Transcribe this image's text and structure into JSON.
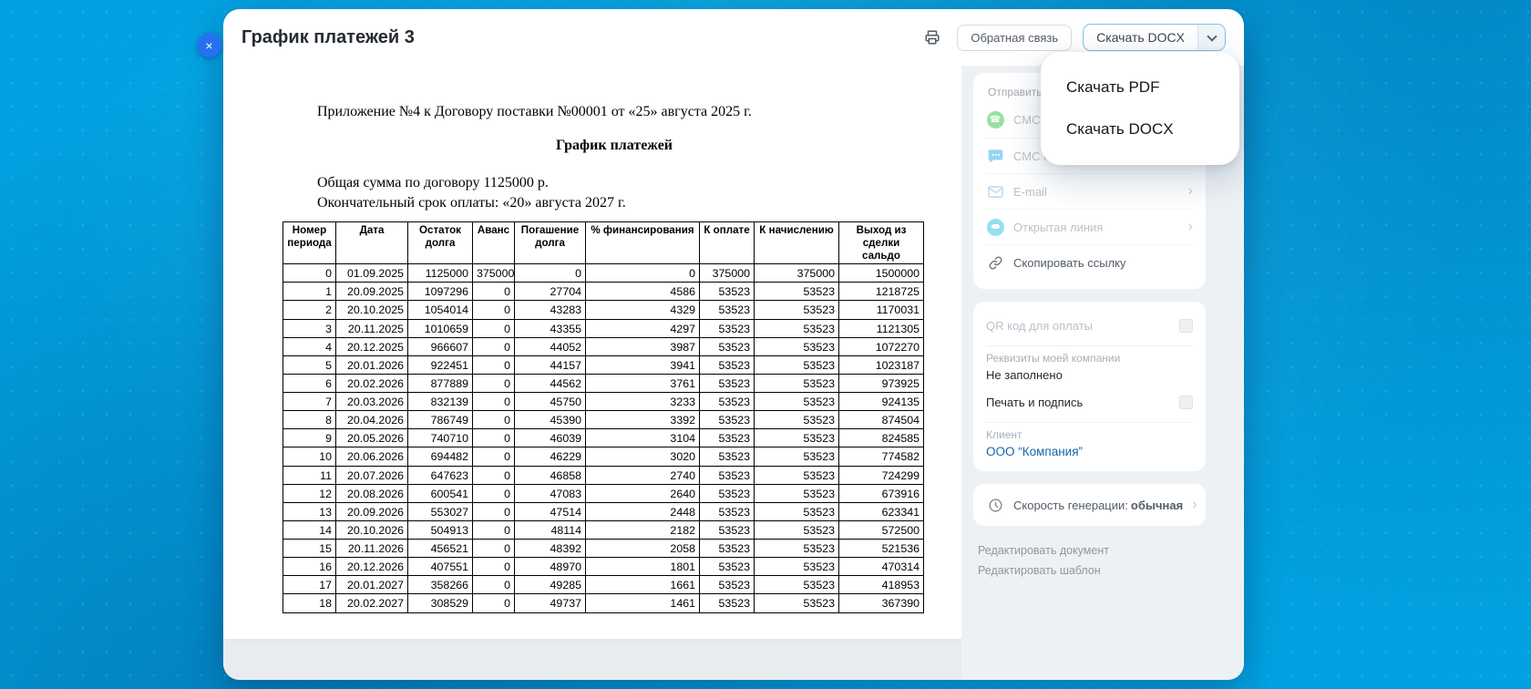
{
  "window": {
    "title": "График платежей 3",
    "close_glyph": "×"
  },
  "toolbar": {
    "feedback_label": "Обратная связь",
    "download_label": "Скачать DOCX"
  },
  "dropdown": {
    "items": [
      "Скачать PDF",
      "Скачать DOCX"
    ]
  },
  "document": {
    "appendix_line": "Приложение №4 к Договору поставки №00001 от «25» августа 2025 г.",
    "title": "График платежей",
    "total_line": "Общая сумма по договору 1125000 р.",
    "deadline_line": "Окончательный срок оплаты: «20» августа 2027 г.",
    "table": {
      "headers": [
        "Номер\nпериода",
        "Дата",
        "Остаток\nдолга",
        "Аванс",
        "Погашение\nдолга",
        "% финансирования",
        "К оплате",
        "К начислению",
        "Выход из\nсделки\nсальдо"
      ],
      "rows": [
        [
          "0",
          "01.09.2025",
          "1125000",
          "375000",
          "0",
          "0",
          "375000",
          "375000",
          "1500000"
        ],
        [
          "1",
          "20.09.2025",
          "1097296",
          "0",
          "27704",
          "4586",
          "53523",
          "53523",
          "1218725"
        ],
        [
          "2",
          "20.10.2025",
          "1054014",
          "0",
          "43283",
          "4329",
          "53523",
          "53523",
          "1170031"
        ],
        [
          "3",
          "20.11.2025",
          "1010659",
          "0",
          "43355",
          "4297",
          "53523",
          "53523",
          "1121305"
        ],
        [
          "4",
          "20.12.2025",
          "966607",
          "0",
          "44052",
          "3987",
          "53523",
          "53523",
          "1072270"
        ],
        [
          "5",
          "20.01.2026",
          "922451",
          "0",
          "44157",
          "3941",
          "53523",
          "53523",
          "1023187"
        ],
        [
          "6",
          "20.02.2026",
          "877889",
          "0",
          "44562",
          "3761",
          "53523",
          "53523",
          "973925"
        ],
        [
          "7",
          "20.03.2026",
          "832139",
          "0",
          "45750",
          "3233",
          "53523",
          "53523",
          "924135"
        ],
        [
          "8",
          "20.04.2026",
          "786749",
          "0",
          "45390",
          "3392",
          "53523",
          "53523",
          "874504"
        ],
        [
          "9",
          "20.05.2026",
          "740710",
          "0",
          "46039",
          "3104",
          "53523",
          "53523",
          "824585"
        ],
        [
          "10",
          "20.06.2026",
          "694482",
          "0",
          "46229",
          "3020",
          "53523",
          "53523",
          "774582"
        ],
        [
          "11",
          "20.07.2026",
          "647623",
          "0",
          "46858",
          "2740",
          "53523",
          "53523",
          "724299"
        ],
        [
          "12",
          "20.08.2026",
          "600541",
          "0",
          "47083",
          "2640",
          "53523",
          "53523",
          "673916"
        ],
        [
          "13",
          "20.09.2026",
          "553027",
          "0",
          "47514",
          "2448",
          "53523",
          "53523",
          "623341"
        ],
        [
          "14",
          "20.10.2026",
          "504913",
          "0",
          "48114",
          "2182",
          "53523",
          "53523",
          "572500"
        ],
        [
          "15",
          "20.11.2026",
          "456521",
          "0",
          "48392",
          "2058",
          "53523",
          "53523",
          "521536"
        ],
        [
          "16",
          "20.12.2026",
          "407551",
          "0",
          "48970",
          "1801",
          "53523",
          "53523",
          "470314"
        ],
        [
          "17",
          "20.01.2027",
          "358266",
          "0",
          "49285",
          "1661",
          "53523",
          "53523",
          "418953"
        ],
        [
          "18",
          "20.02.2027",
          "308529",
          "0",
          "49737",
          "1461",
          "53523",
          "53523",
          "367390"
        ]
      ]
    }
  },
  "sidebar": {
    "send": {
      "header": "Отправить кл",
      "items": [
        {
          "label": "СМС к"
        },
        {
          "label": "СМС к"
        },
        {
          "label": "E-mail"
        },
        {
          "label": "Открытая линия"
        },
        {
          "label": "Скопировать ссылку"
        }
      ]
    },
    "options": {
      "qr_label": "QR код для оплаты",
      "requisites_label": "Реквизиты моей компании",
      "requisites_value": "Не заполнено",
      "stamp_label": "Печать и подпись",
      "client_label": "Клиент",
      "client_value": "ООО “Компания”"
    },
    "generation": {
      "label": "Скорость генерации:",
      "value": "обычная"
    },
    "links": [
      "Редактировать документ",
      "Редактировать шаблон"
    ]
  },
  "colors": {
    "background": "#02a2e2",
    "accent_blue": "#2472f2",
    "link_blue": "#1565ad",
    "whatsapp_green": "#43c854"
  }
}
